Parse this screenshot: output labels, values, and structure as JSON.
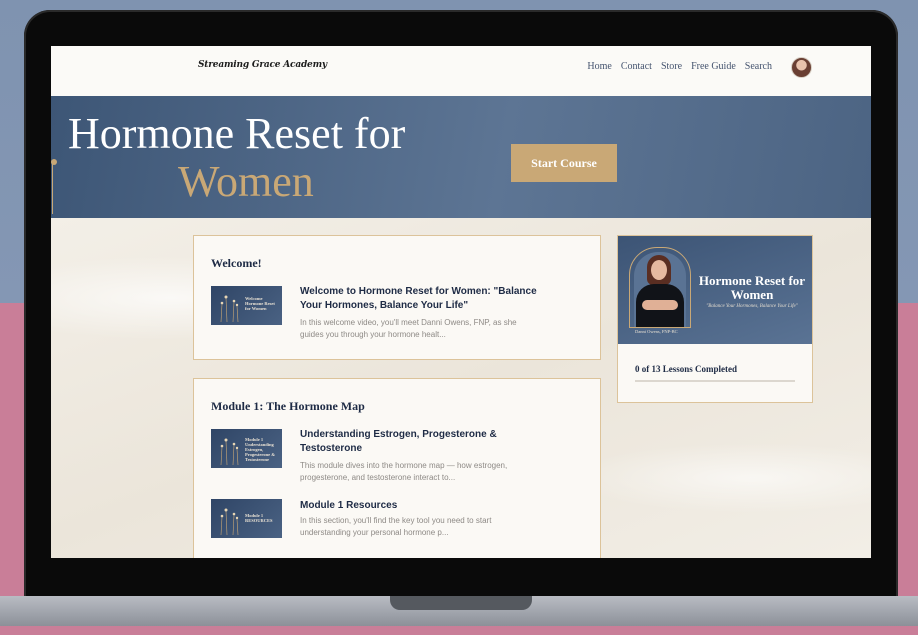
{
  "site": {
    "logo_text": "Streaming Grace Academy",
    "nav": [
      "Home",
      "Contact",
      "Store",
      "Free Guide",
      "Search"
    ]
  },
  "hero": {
    "title_line1": "Hormone Reset for",
    "title_line2": "Women",
    "start_button": "Start Course"
  },
  "welcome_card": {
    "title": "Welcome!",
    "lesson": {
      "thumb_text": "Welcome Hormone Reset for Women",
      "title": "Welcome to Hormone Reset for Women: \"Balance Your Hormones, Balance Your Life\"",
      "description": "In this welcome video, you'll meet Danni Owens, FNP, as she guides you through your hormone healt..."
    }
  },
  "module1_card": {
    "title": "Module 1: The Hormone Map",
    "lessons": [
      {
        "thumb_text": "Module 1 Understanding Estrogen, Progesterone & Testosterone",
        "title": "Understanding Estrogen, Progesterone & Testosterone",
        "description": "This module dives into the hormone map — how estrogen, progesterone, and testosterone interact to..."
      },
      {
        "thumb_text": "Module 1 RESOURCES",
        "title": "Module 1 Resources",
        "description": "In this section, you'll find the key tool you need to start understanding your personal hormone p..."
      }
    ]
  },
  "sidebar": {
    "course_title": "Hormone Reset for Women",
    "tagline": "\"Balance Your Hormones, Balance Your Life\"",
    "photo_caption": "Danni Owens, FNP-BC",
    "progress_text": "0 of 13 Lessons Completed",
    "progress_fraction": 0
  },
  "colors": {
    "navy": "#1e2b45",
    "gold": "#c9a876",
    "hero_blue": "#4c6483"
  }
}
